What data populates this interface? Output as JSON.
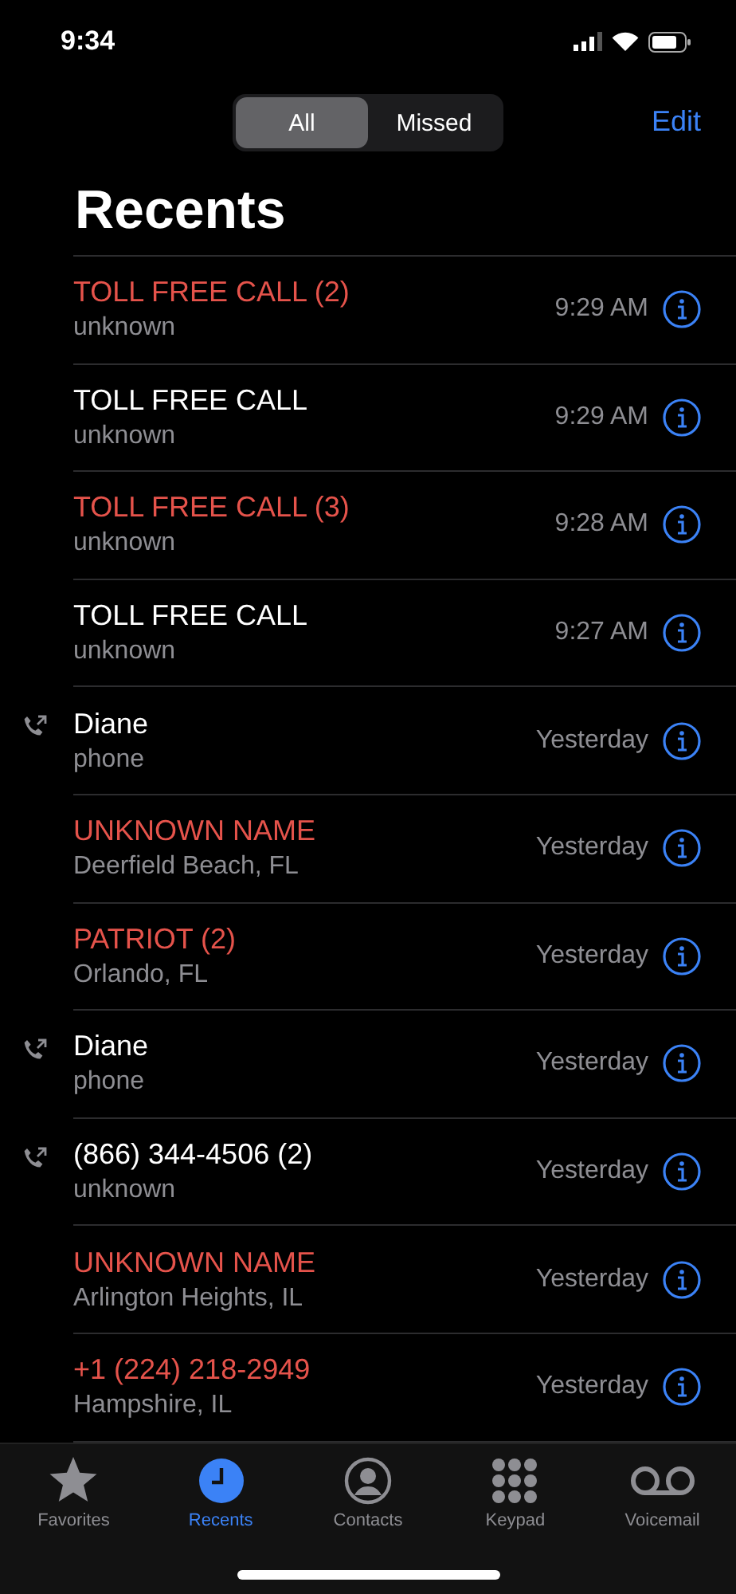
{
  "status_bar": {
    "time": "9:34"
  },
  "segments": [
    {
      "label": "All",
      "selected": true
    },
    {
      "label": "Missed",
      "selected": false
    }
  ],
  "edit_button": "Edit",
  "title": "Recents",
  "calls": [
    {
      "name": "TOLL FREE CALL (2)",
      "detail": "unknown",
      "time": "9:29 AM",
      "missed": true,
      "outgoing": false
    },
    {
      "name": "TOLL FREE CALL",
      "detail": "unknown",
      "time": "9:29 AM",
      "missed": false,
      "outgoing": false
    },
    {
      "name": "TOLL FREE CALL (3)",
      "detail": "unknown",
      "time": "9:28 AM",
      "missed": true,
      "outgoing": false
    },
    {
      "name": "TOLL FREE CALL",
      "detail": "unknown",
      "time": "9:27 AM",
      "missed": false,
      "outgoing": false
    },
    {
      "name": "Diane",
      "detail": "phone",
      "time": "Yesterday",
      "missed": false,
      "outgoing": true
    },
    {
      "name": "UNKNOWN NAME",
      "detail": "Deerfield Beach, FL",
      "time": "Yesterday",
      "missed": true,
      "outgoing": false
    },
    {
      "name": "PATRIOT (2)",
      "detail": "Orlando, FL",
      "time": "Yesterday",
      "missed": true,
      "outgoing": false
    },
    {
      "name": "Diane",
      "detail": "phone",
      "time": "Yesterday",
      "missed": false,
      "outgoing": true
    },
    {
      "name": "(866) 344-4506 (2)",
      "detail": "unknown",
      "time": "Yesterday",
      "missed": false,
      "outgoing": true
    },
    {
      "name": "UNKNOWN NAME",
      "detail": "Arlington Heights, IL",
      "time": "Yesterday",
      "missed": true,
      "outgoing": false
    },
    {
      "name": "+1 (224) 218-2949",
      "detail": "Hampshire, IL",
      "time": "Yesterday",
      "missed": true,
      "outgoing": false
    }
  ],
  "tab_bar": [
    {
      "kind": "favorites",
      "label": "Favorites",
      "selected": false
    },
    {
      "kind": "recents",
      "label": "Recents",
      "selected": true
    },
    {
      "kind": "contacts",
      "label": "Contacts",
      "selected": false
    },
    {
      "kind": "keypad",
      "label": "Keypad",
      "selected": false
    },
    {
      "kind": "voicemail",
      "label": "Voicemail",
      "selected": false
    }
  ]
}
